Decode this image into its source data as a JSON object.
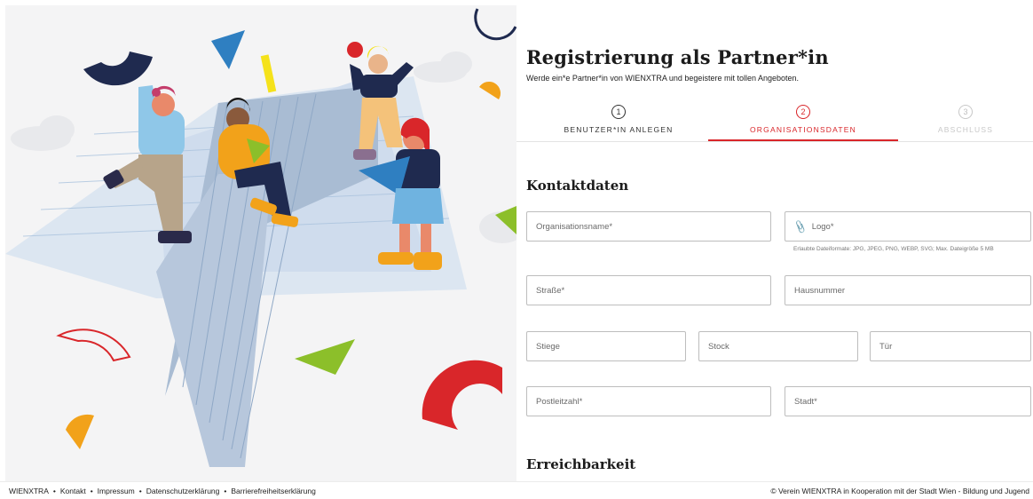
{
  "form": {
    "title": "Registrierung als Partner*in",
    "subtitle": "Werde ein*e Partner*in von WIENXTRA und begeistere mit tollen Angeboten."
  },
  "stepper": {
    "steps": [
      {
        "number": "1",
        "label": "BENUTZER*IN ANLEGEN",
        "state": "done"
      },
      {
        "number": "2",
        "label": "ORGANISATIONSDATEN",
        "state": "active"
      },
      {
        "number": "3",
        "label": "ABSCHLUSS",
        "state": "upcoming"
      }
    ]
  },
  "sections": {
    "kontakt": "Kontaktdaten",
    "erreichbarkeit": "Erreichbarkeit"
  },
  "fields": {
    "organisationsname": {
      "placeholder": "Organisationsname*",
      "value": ""
    },
    "logo": {
      "placeholder": "Logo*",
      "icon": "paperclip-icon"
    },
    "logo_hint": "Erlaubte Dateiformate: JPG, JPEG, PNG, WEBP, SVG; Max. Dateigröße 5 MB",
    "strasse": {
      "placeholder": "Straße*",
      "value": ""
    },
    "hausnummer": {
      "placeholder": "Hausnummer",
      "value": ""
    },
    "stiege": {
      "placeholder": "Stiege",
      "value": ""
    },
    "stock": {
      "placeholder": "Stock",
      "value": ""
    },
    "tuer": {
      "placeholder": "Tür",
      "value": ""
    },
    "postleitzahl": {
      "placeholder": "Postleitzahl*",
      "value": ""
    },
    "stadt": {
      "placeholder": "Stadt*",
      "value": ""
    }
  },
  "footer": {
    "links": [
      "WIENXTRA",
      "Kontakt",
      "Impressum",
      "Datenschutzerklärung",
      "Barrierefreiheitserklärung"
    ],
    "separator": "•",
    "copyright": "© Verein WIENXTRA in Kooperation mit der Stadt Wien - Bildung und Jugend"
  },
  "colors": {
    "accent_red": "#d9262a",
    "navy": "#1f2a4f",
    "blue": "#2f7fc1",
    "yellow": "#f5e21b",
    "orange": "#f2a21a",
    "green": "#8cbf2a"
  }
}
